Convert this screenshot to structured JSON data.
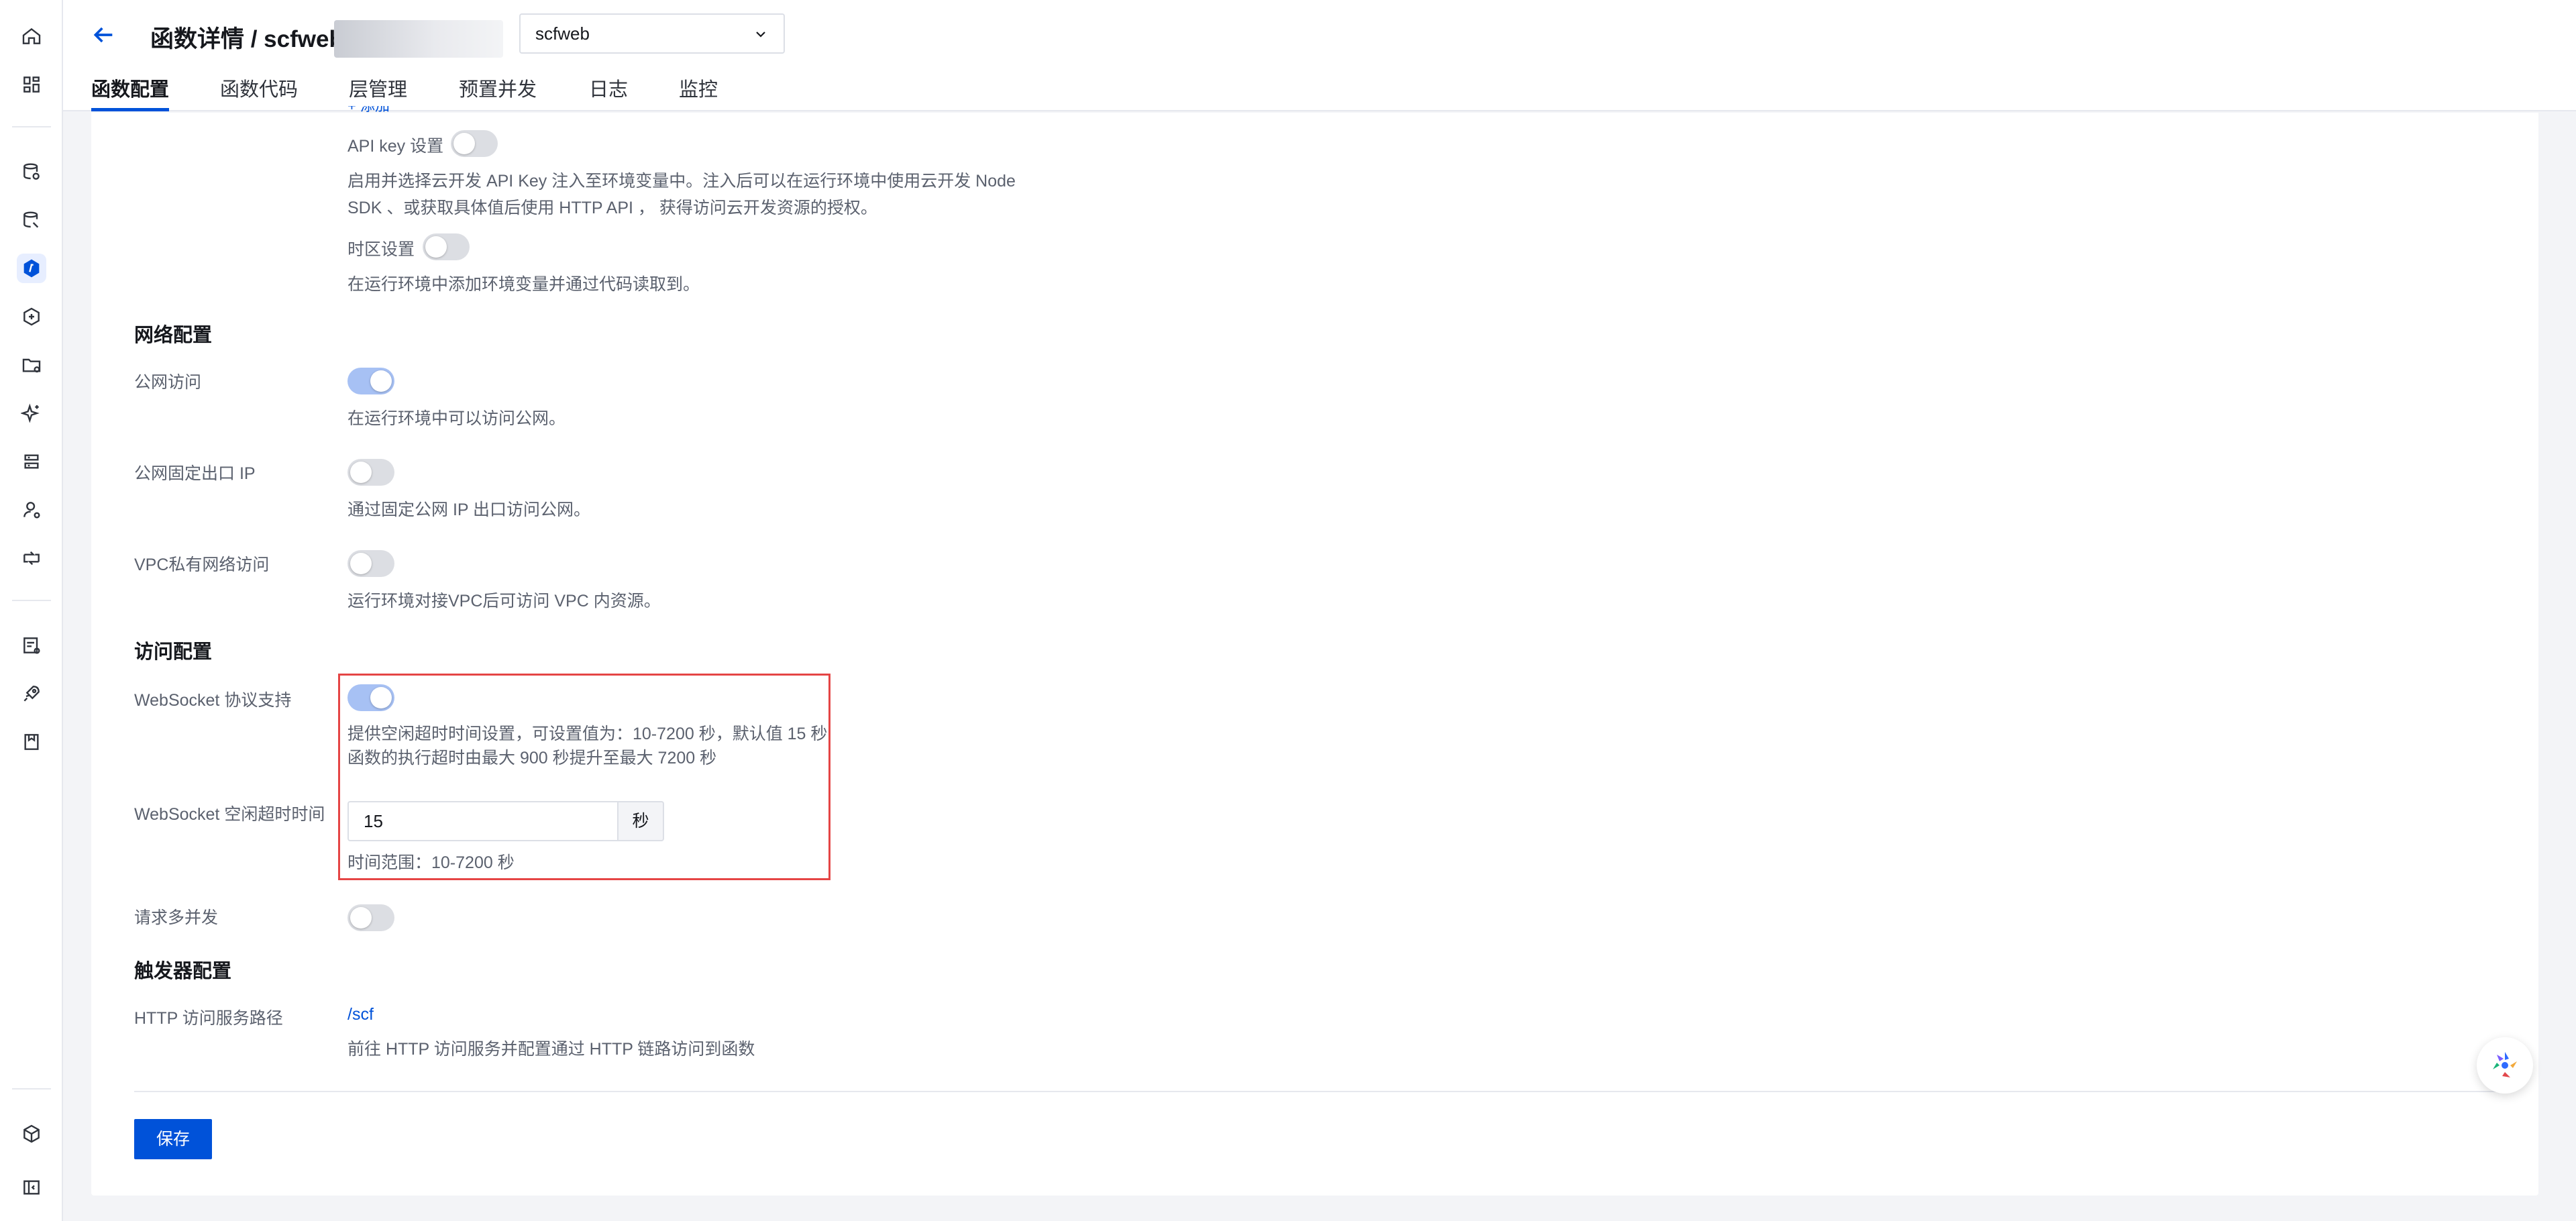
{
  "header": {
    "title": "函数详情 / scfweb",
    "back_icon": "arrow-left-icon",
    "function_select": {
      "value": "scfweb"
    }
  },
  "tabs": [
    {
      "label": "函数配置",
      "active": true
    },
    {
      "label": "函数代码"
    },
    {
      "label": "层管理"
    },
    {
      "label": "预置并发"
    },
    {
      "label": "日志"
    },
    {
      "label": "监控"
    }
  ],
  "env": {
    "partial_link": "+ 添加",
    "api_key_label": "API key 设置",
    "api_key_enabled": false,
    "api_key_desc_1": "启用并选择云开发 API Key 注入至环境变量中。注入后可以在运行环境中使用云开发 Node",
    "api_key_desc_2": "SDK 、或获取具体值后使用 HTTP API ， 获得访问云开发资源的授权。",
    "timezone_label": "时区设置",
    "timezone_enabled": false,
    "timezone_desc": "在运行环境中添加环境变量并通过代码读取到。"
  },
  "network": {
    "title": "网络配置",
    "public_label": "公网访问",
    "public_enabled": true,
    "public_desc": "在运行环境中可以访问公网。",
    "fixed_ip_label": "公网固定出口 IP",
    "fixed_ip_enabled": false,
    "fixed_ip_desc": "通过固定公网 IP 出口访问公网。",
    "vpc_label": "VPC私有网络访问",
    "vpc_enabled": false,
    "vpc_desc": "运行环境对接VPC后可访问 VPC 内资源。"
  },
  "access": {
    "title": "访问配置",
    "websocket_label": "WebSocket 协议支持",
    "websocket_enabled": true,
    "websocket_desc_1": "提供空闲超时时间设置，可设置值为：10-7200 秒，默认值 15 秒",
    "websocket_desc_2": "函数的执行超时由最大 900 秒提升至最大 7200 秒",
    "idle_timeout_label": "WebSocket 空闲超时时间",
    "idle_timeout_value": "15",
    "idle_timeout_unit": "秒",
    "idle_timeout_hint": "时间范围：10-7200 秒",
    "multi_concurrency_label": "请求多并发",
    "multi_concurrency_enabled": false
  },
  "trigger": {
    "title": "触发器配置",
    "http_path_label": "HTTP 访问服务路径",
    "http_path_value": "/scf",
    "http_path_desc": "前往 HTTP 访问服务并配置通过 HTTP 链路访问到函数"
  },
  "footer": {
    "save_label": "保存"
  },
  "colors": {
    "primary": "#0052d9",
    "highlight": "#e54545",
    "switch_on": "#a7c1f4",
    "switch_off": "#dcdee3"
  },
  "rail_icons": [
    "home-icon",
    "dashboard-icon",
    "database-icon",
    "database-search-icon",
    "function-icon",
    "cloud-sync-icon",
    "folder-icon",
    "ai-sparkle-icon",
    "storage-icon",
    "user-icon",
    "refresh-icon",
    "document-icon",
    "rocket-icon",
    "package-icon",
    "plugin-icon",
    "collapse-icon"
  ],
  "floating_help_icon": "assistant-logo-icon"
}
